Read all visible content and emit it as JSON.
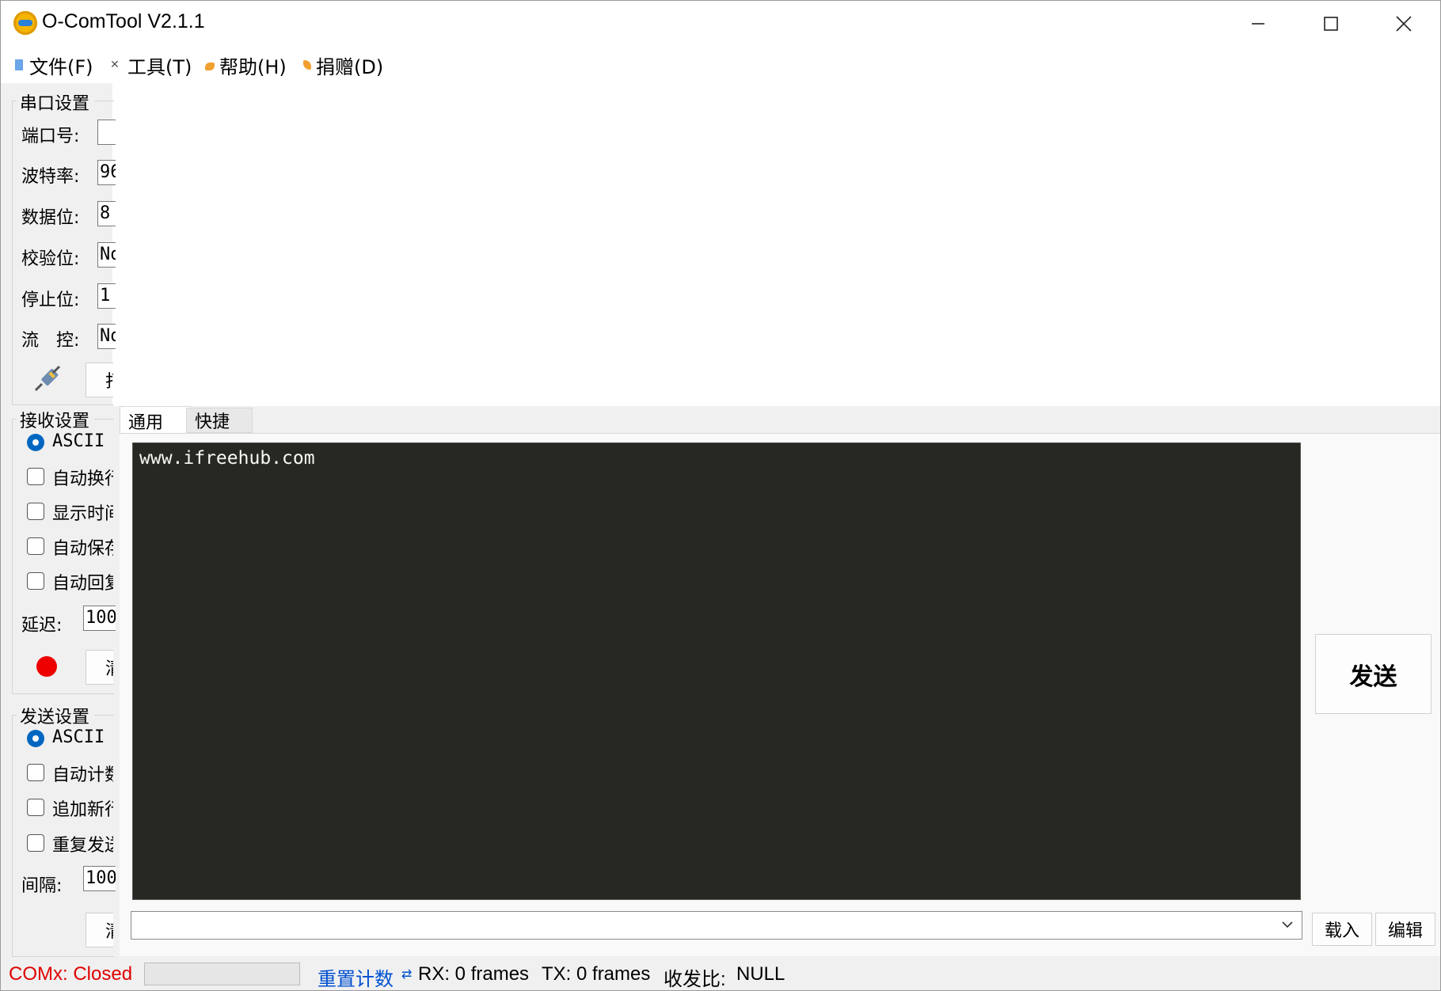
{
  "window": {
    "title": "O-ComTool V2.1.1"
  },
  "menu": [
    {
      "label": "文件(F)",
      "icon": "file-icon"
    },
    {
      "label": "工具(T)",
      "icon": "tools-icon"
    },
    {
      "label": "帮助(H)",
      "icon": "help-icon"
    },
    {
      "label": "捐赠(D)",
      "icon": "donate-icon"
    }
  ],
  "serial": {
    "title": "串口设置",
    "port_label": "端口号:",
    "port_value": "",
    "baud_label": "波特率:",
    "baud_value": "96",
    "databits_label": "数据位:",
    "databits_value": "8",
    "parity_label": "校验位:",
    "parity_value": "No",
    "stopbits_label": "停止位:",
    "stopbits_value": "1",
    "flow_label": "流　控:",
    "flow_value": "No",
    "open_button": "打",
    "plug_icon": "plug-icon"
  },
  "receive": {
    "title": "接收设置",
    "ascii": "ASCII",
    "options": [
      "自动换行",
      "显示时间",
      "自动保存",
      "自动回复"
    ],
    "delay_label": "延迟:",
    "delay_value": "100",
    "clear_button": "清",
    "record_icon": "record-icon",
    "record_color": "#ee0000"
  },
  "send": {
    "title": "发送设置",
    "ascii": "ASCII",
    "options": [
      "自动计数",
      "追加新行",
      "重复发送"
    ],
    "interval_label": "间隔:",
    "interval_value": "100",
    "clear_button": "清"
  },
  "tabs": [
    {
      "label": "通用"
    },
    {
      "label": "快捷"
    }
  ],
  "console": {
    "text": "www.ifreehub.com",
    "background": "#272822"
  },
  "send_button": "发送",
  "input": {
    "value": ""
  },
  "load_button": "载入",
  "edit_button": "编辑",
  "status": {
    "port_status": "COMx: Closed",
    "port_status_color": "#e00000",
    "progress": 0,
    "reset_link": "重置计数",
    "reset_color": "#0050d0",
    "rx": "RX: 0 frames",
    "tx": "TX: 0 frames",
    "ratio_label": "收发比:",
    "ratio_value": "NULL"
  }
}
